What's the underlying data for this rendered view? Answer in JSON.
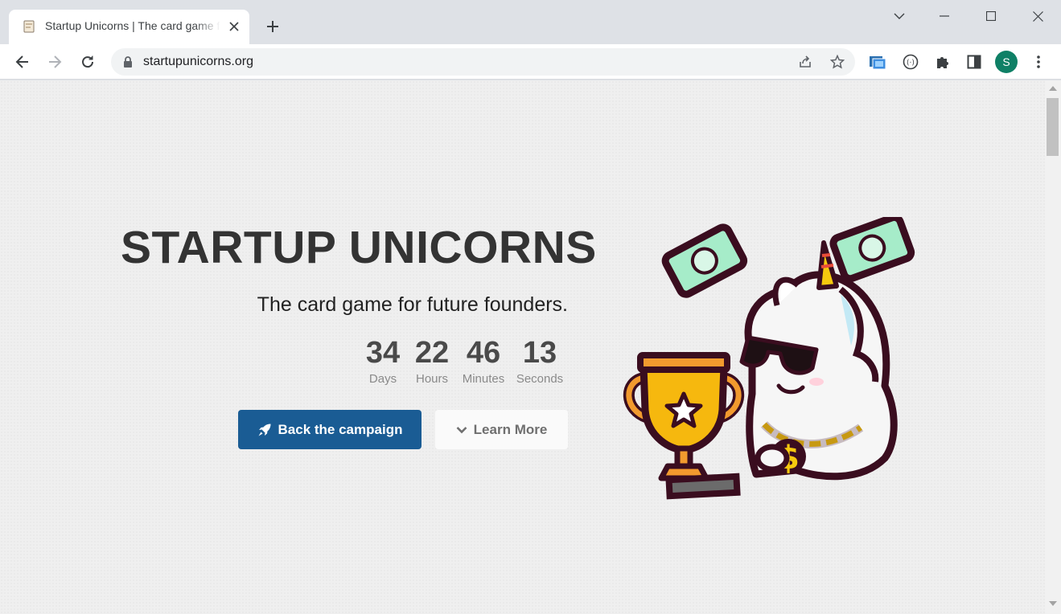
{
  "browser": {
    "tab": {
      "title": "Startup Unicorns | The card game for future founders"
    },
    "url": "startupunicorns.org",
    "profile_initial": "S"
  },
  "hero": {
    "title": "STARTUP UNICORNS",
    "subtitle": "The card game for future founders.",
    "countdown": [
      {
        "value": "34",
        "label": "Days"
      },
      {
        "value": "22",
        "label": "Hours"
      },
      {
        "value": "46",
        "label": "Minutes"
      },
      {
        "value": "13",
        "label": "Seconds"
      }
    ],
    "primary_button": {
      "label": "Back the campaign",
      "icon": "rocket-icon"
    },
    "secondary_button": {
      "label": "Learn More",
      "icon": "chevron-down-icon"
    }
  },
  "colors": {
    "primary": "#1a5c94",
    "profile": "#0f8066",
    "title_text": "#333333"
  }
}
